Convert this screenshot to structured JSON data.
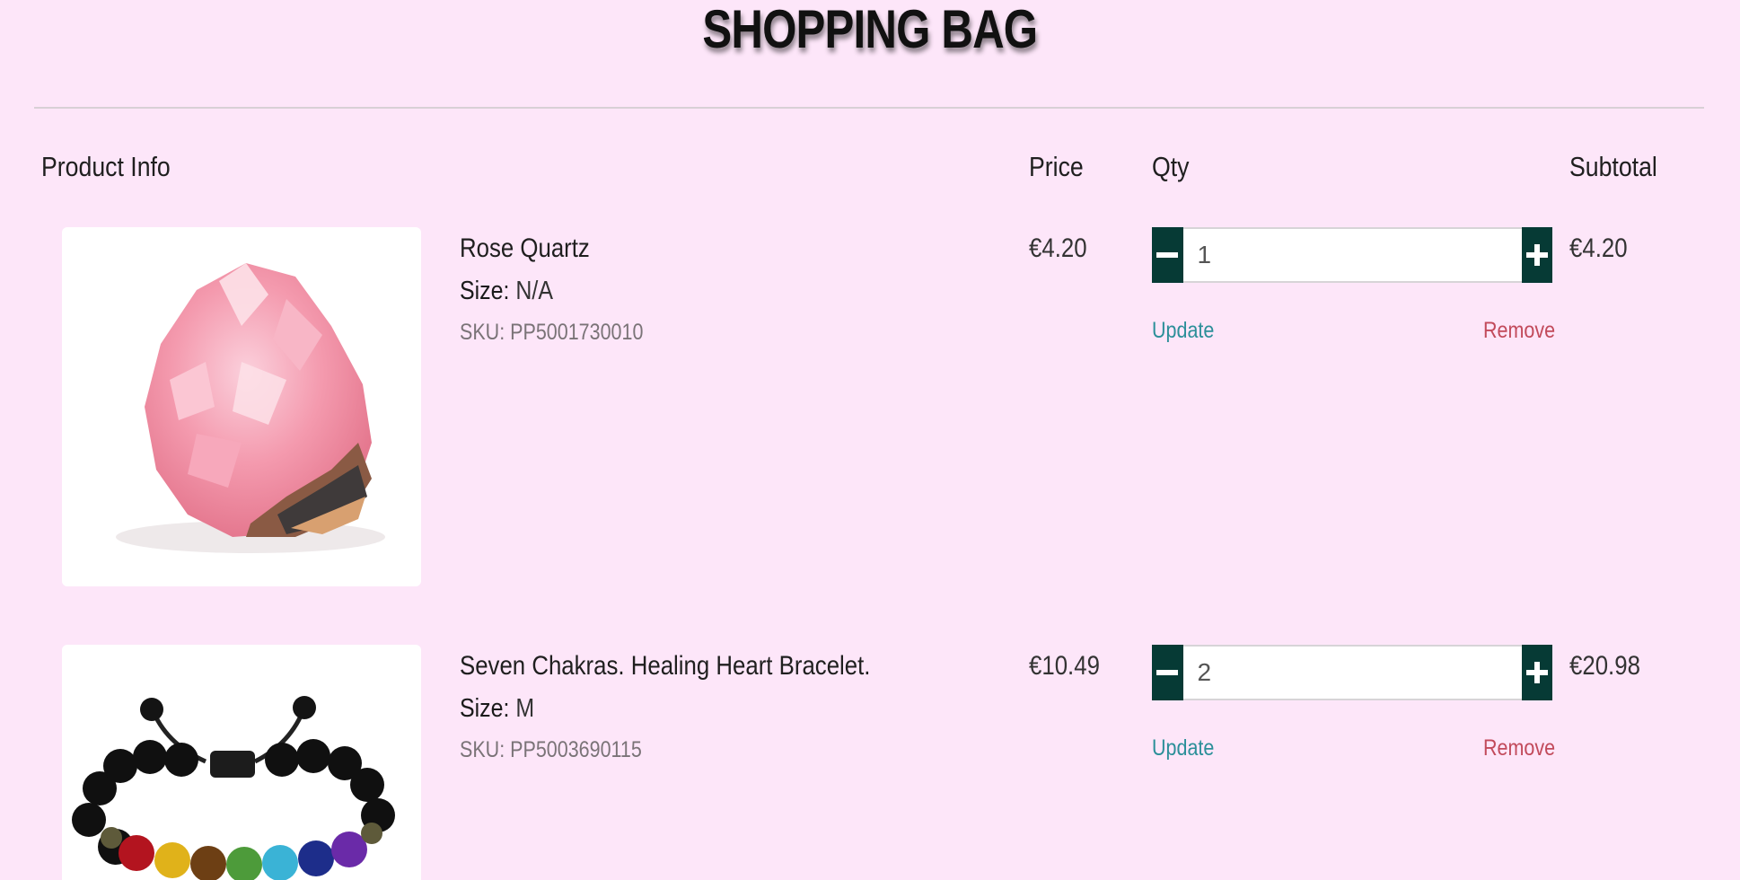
{
  "page": {
    "title": "SHOPPING BAG",
    "background_color": "#fde6f9"
  },
  "table": {
    "headers": {
      "product": "Product Info",
      "price": "Price",
      "qty": "Qty",
      "subtotal": "Subtotal"
    }
  },
  "items": [
    {
      "name": "Rose Quartz",
      "size_label": "Size:",
      "size_value": "N/A",
      "sku": "SKU: PP5001730010",
      "price": "€4.20",
      "qty": "1",
      "subtotal": "€4.20",
      "update_label": "Update",
      "remove_label": "Remove",
      "image_icon": "rose-quartz-crystal"
    },
    {
      "name": "Seven Chakras. Healing Heart Bracelet.",
      "size_label": "Size:",
      "size_value": "M",
      "sku": "SKU: PP5003690115",
      "price": "€10.49",
      "qty": "2",
      "subtotal": "€20.98",
      "update_label": "Update",
      "remove_label": "Remove",
      "image_icon": "chakra-bead-bracelet"
    }
  ],
  "colors": {
    "stepper_button": "#063a35",
    "update_link": "#2b8f99",
    "remove_link": "#c24a5b"
  },
  "icons": {
    "decrement": "minus-icon",
    "increment": "plus-icon"
  }
}
